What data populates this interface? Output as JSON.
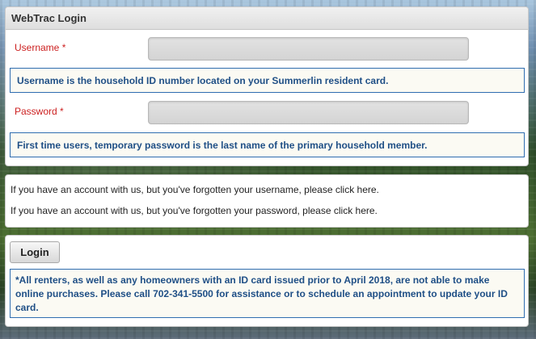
{
  "login_panel": {
    "title": "WebTrac Login",
    "username_label": "Username *",
    "username_value": "",
    "username_hint": "Username is the household ID number located on your Summerlin resident card.",
    "password_label": "Password *",
    "password_value": "",
    "password_hint": "First time users, temporary password is the last name of the primary household member."
  },
  "recovery": {
    "forgot_username": "If you have an account with us, but you've forgotten your username, please click here.",
    "forgot_password": "If you have an account with us, but you've forgotten your password, please click here."
  },
  "actions": {
    "login_label": "Login",
    "notice": "*All renters, as well as any homeowners with an ID card issued prior to April 2018, are not able to make online purchases. Please call 702-341-5500 for assistance or to schedule an appointment to update your ID card."
  },
  "colors": {
    "required_label": "#cc1f1f",
    "hint_text": "#1f4f86",
    "hint_border": "#2f6db0"
  }
}
